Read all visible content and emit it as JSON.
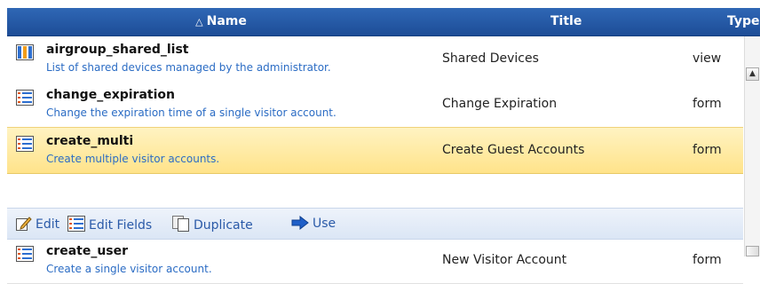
{
  "header": {
    "sort_indicator": "△",
    "name": "Name",
    "title": "Title",
    "type": "Type"
  },
  "rows": [
    {
      "icon": "view-columns-icon",
      "name": "airgroup_shared_list",
      "description": "List of shared devices managed by the administrator.",
      "title": "Shared Devices",
      "type": "view"
    },
    {
      "icon": "form-icon",
      "name": "change_expiration",
      "description": "Change the expiration time of a single visitor account.",
      "title": "Change Expiration",
      "type": "form"
    },
    {
      "icon": "form-icon",
      "name": "create_multi",
      "description": "Create multiple visitor accounts.",
      "title": "Create Guest Accounts",
      "type": "form",
      "selected": true
    },
    {
      "icon": "form-icon",
      "name": "create_user",
      "description": "Create a single visitor account.",
      "title": "New Visitor Account",
      "type": "form"
    }
  ],
  "actions": {
    "edit": "Edit",
    "edit_fields": "Edit Fields",
    "duplicate": "Duplicate",
    "use": "Use"
  },
  "colors": {
    "header_bg": "#2454a3",
    "link": "#2b6cc4",
    "selected_row": "#ffe99a",
    "action_bar": "#e3ebf7"
  }
}
